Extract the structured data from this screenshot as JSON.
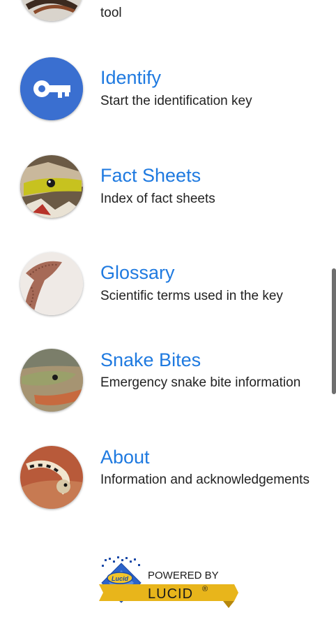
{
  "menu": {
    "partial_subtitle": "tool",
    "items": [
      {
        "title": "Identify",
        "subtitle": "Start the identification key"
      },
      {
        "title": "Fact Sheets",
        "subtitle": "Index of fact sheets"
      },
      {
        "title": "Glossary",
        "subtitle": "Scientific terms used in the key"
      },
      {
        "title": "Snake Bites",
        "subtitle": "Emergency snake bite information"
      },
      {
        "title": "About",
        "subtitle": "Information and acknowledgements"
      }
    ]
  },
  "footer": {
    "powered_by": "POWERED BY",
    "brand": "LUCID",
    "brand_mark": "®",
    "logo_text": "Lucid"
  },
  "colors": {
    "accent": "#1f7ae0",
    "identify_bg": "#3a6fd0",
    "lucid_gold": "#e8b51b"
  }
}
